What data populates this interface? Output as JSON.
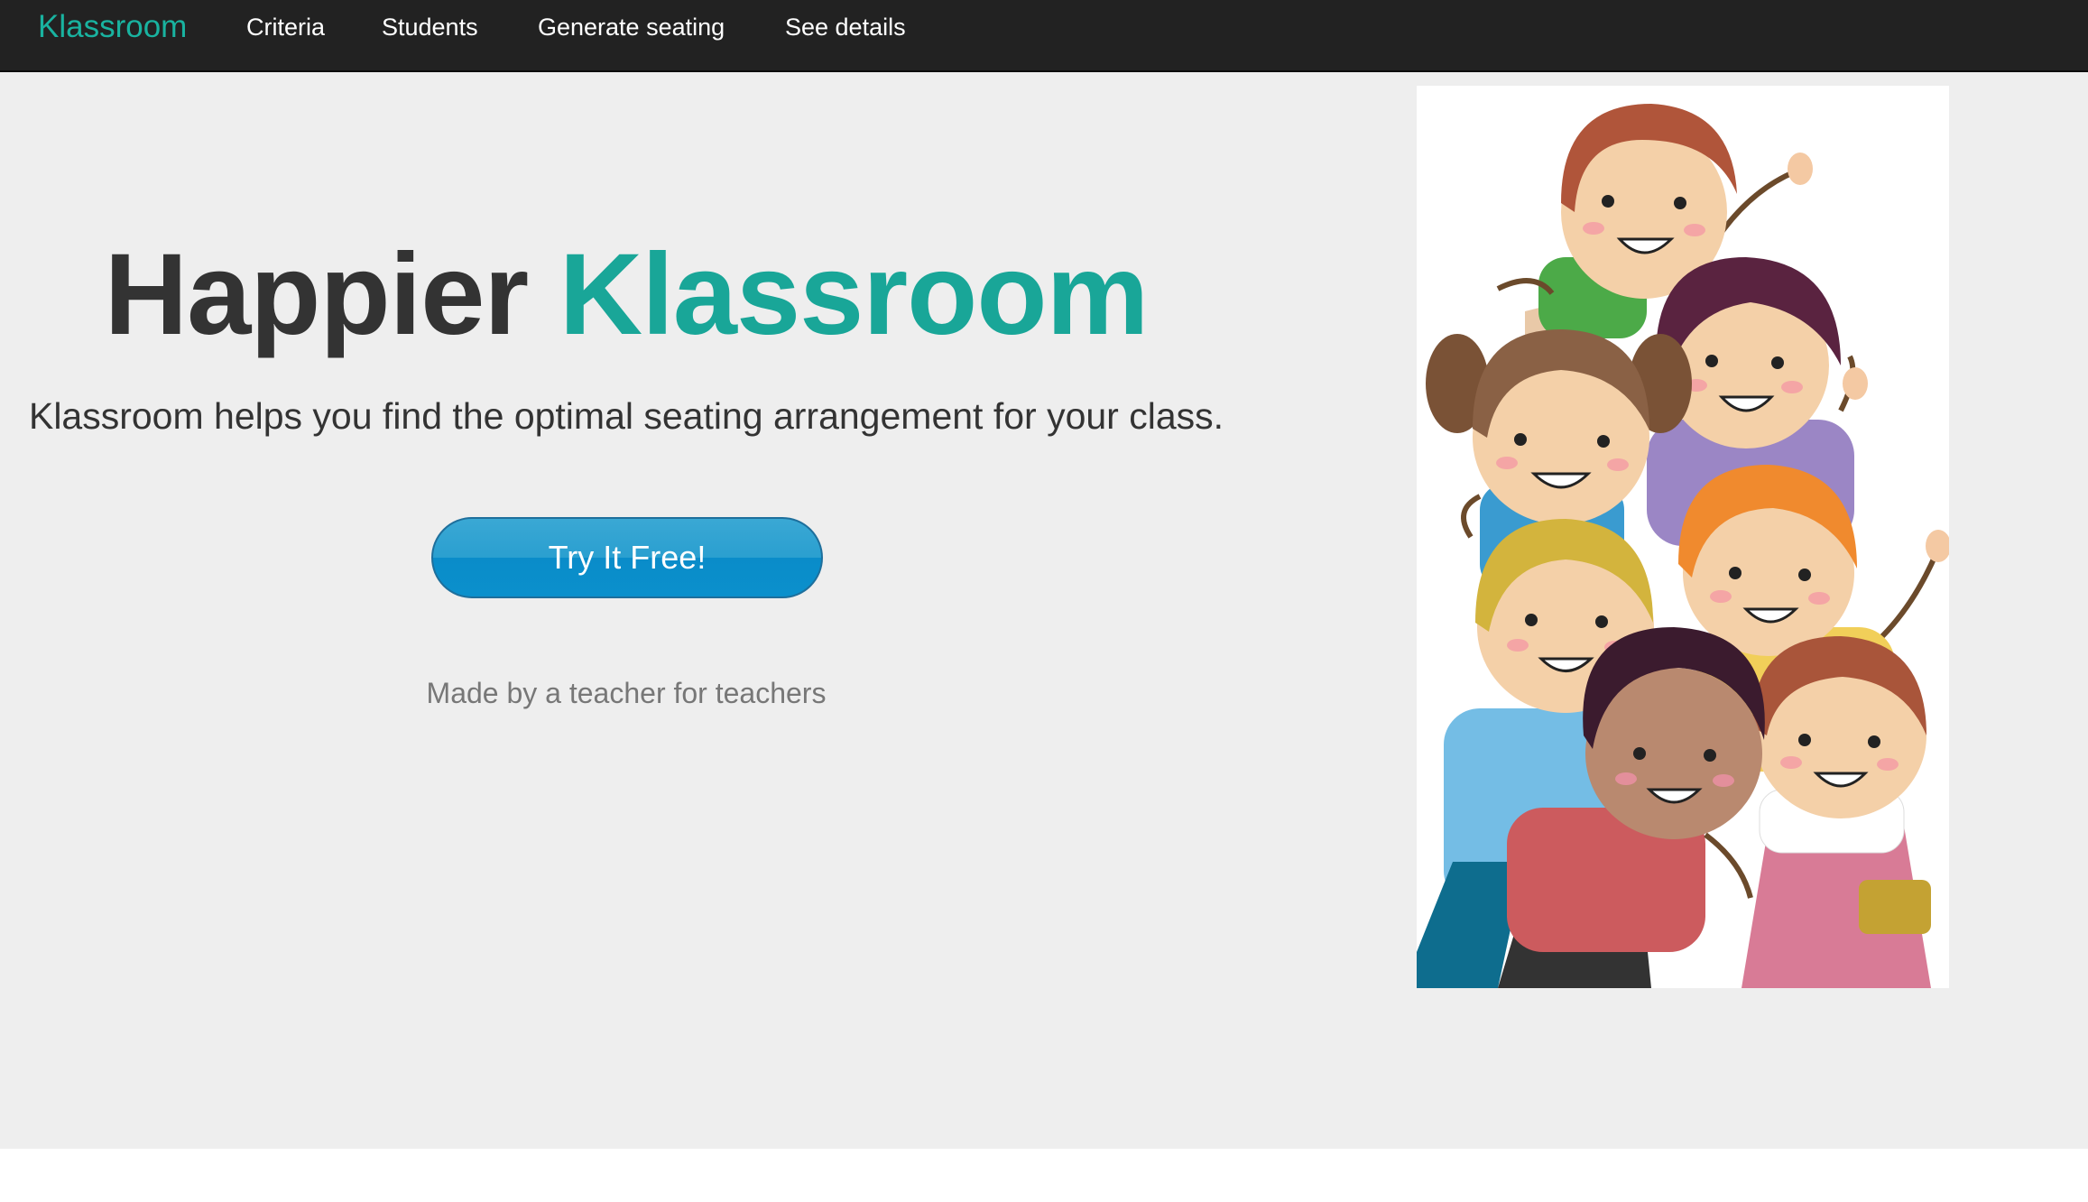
{
  "navbar": {
    "brand": "Klassroom",
    "links": [
      {
        "label": "Criteria"
      },
      {
        "label": "Students"
      },
      {
        "label": "Generate seating"
      },
      {
        "label": "See details"
      }
    ]
  },
  "hero": {
    "headline_part1": "Happier ",
    "headline_part2": "Klassroom",
    "subtitle": "Klassroom helps you find the optimal seating arrangement for your class.",
    "cta_label": "Try It Free!",
    "tagline": "Made by a teacher for teachers"
  },
  "colors": {
    "navbar_bg": "#222222",
    "brand": "#19b3a0",
    "accent": "#19a698",
    "hero_bg": "#eeeeee",
    "cta": "#1a9ad3"
  },
  "illustration": {
    "icon": "children-group-illustration"
  }
}
